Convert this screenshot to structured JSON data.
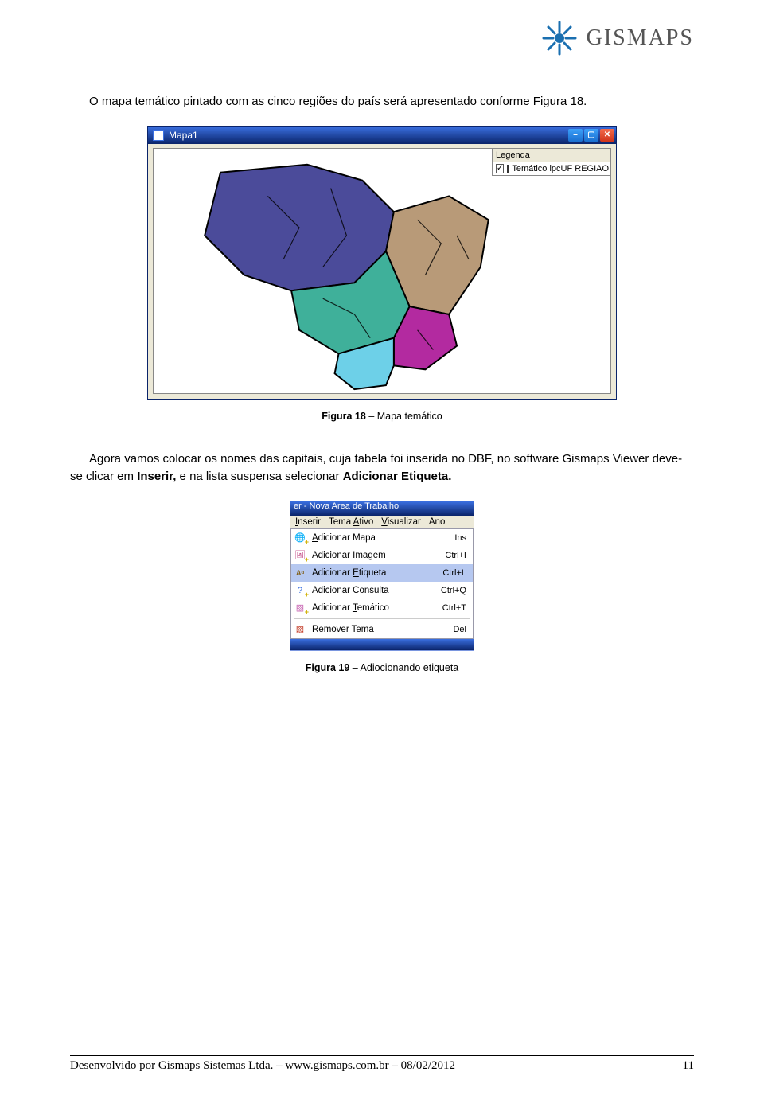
{
  "brand": "GISMAPS",
  "para1": "O mapa temático pintado com as cinco regiões do país será apresentado conforme Figura 18.",
  "map_window": {
    "title": "Mapa1",
    "legend_title": "Legenda",
    "legend_item": "Temático ipcUF REGIAO"
  },
  "caption1_bold": "Figura 18",
  "caption1_rest": " – Mapa temático",
  "para2_pre": "Agora vamos colocar os nomes das capitais, cuja tabela foi inserida no DBF, no software Gismaps Viewer deve-se clicar em ",
  "para2_bold1": "Inserir,",
  "para2_mid": " e na lista suspensa selecionar ",
  "para2_bold2": "Adicionar Etiqueta.",
  "menu": {
    "titlebar": "er - Nova Area de Trabalho",
    "menubar": [
      "Inserir",
      "Tema Ativo",
      "Visualizar",
      "Ano"
    ],
    "menubar_underline": [
      "I",
      "A",
      "V",
      ""
    ],
    "items": [
      {
        "label": "Adicionar Mapa",
        "u": "A",
        "shortcut": "Ins",
        "icon": "globe",
        "sel": false
      },
      {
        "label": "Adicionar Imagem",
        "u": "I",
        "shortcut": "Ctrl+I",
        "icon": "img",
        "sel": false
      },
      {
        "label": "Adicionar Etiqueta",
        "u": "E",
        "shortcut": "Ctrl+L",
        "icon": "label",
        "sel": true
      },
      {
        "label": "Adicionar Consulta",
        "u": "C",
        "shortcut": "Ctrl+Q",
        "icon": "query",
        "sel": false
      },
      {
        "label": "Adicionar Temático",
        "u": "T",
        "shortcut": "Ctrl+T",
        "icon": "thematic",
        "sel": false
      },
      {
        "label": "Remover Tema",
        "u": "R",
        "shortcut": "Del",
        "icon": "remove",
        "sel": false
      }
    ]
  },
  "caption2_bold": "Figura 19",
  "caption2_rest": " – Adiocionando etiqueta",
  "footer_left": "Desenvolvido por Gismaps Sistemas Ltda. – www.gismaps.com.br – 08/02/2012",
  "footer_right": "11"
}
